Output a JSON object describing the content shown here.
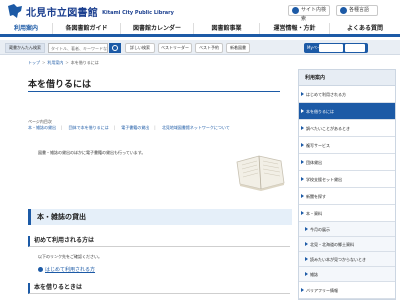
{
  "header": {
    "logo_text": "北見市立図書館",
    "logo_en": "Kitami City Public Library",
    "sitemap_button": "サイト内検索",
    "language_button": "各種言語"
  },
  "nav": {
    "items": [
      "利用案内",
      "各図書館ガイド",
      "図書館カレンダー",
      "図書館事業",
      "運営情報・方針",
      "よくある質問"
    ],
    "active_index": 0
  },
  "searchbar": {
    "label": "蔵書かんたん検索",
    "placeholder": "タイトル、著者、キーワードなど",
    "buttons": [
      "詳しい検索",
      "ベストリーダー",
      "ベスト予約",
      "新着図書"
    ],
    "mypage_label": "Myページ"
  },
  "breadcrumb": [
    "トップ",
    "利用案内",
    "本を借りるには"
  ],
  "main": {
    "title": "本を借りるには",
    "toc_heading": "ページ内目次",
    "toc_links": [
      "本・雑誌の貸出",
      "団体で本を借りるには",
      "電子書籍の貸出",
      "北見地域図書館ネットワークについて"
    ],
    "intro": "図書・雑誌の貸出のほかに電子書籍の貸出も行っています。",
    "section_title": "本・雑誌の貸出",
    "sub1_title": "初めて利用される方は",
    "sub1_text": "以下のリンク先をご確認ください。",
    "sub1_link": "はじめて利用される方",
    "sub2_title": "本を借りるときは"
  },
  "side": {
    "heading": "利用案内",
    "items": [
      {
        "label": "はじめて利用される方",
        "active": false,
        "sub": false
      },
      {
        "label": "本を借りるには",
        "active": true,
        "sub": false
      },
      {
        "label": "調べたいことがあるとき",
        "active": false,
        "sub": false
      },
      {
        "label": "複写サービス",
        "active": false,
        "sub": false
      },
      {
        "label": "団体貸出",
        "active": false,
        "sub": false
      },
      {
        "label": "学校支援セット貸出",
        "active": false,
        "sub": false
      },
      {
        "label": "新聞を探す",
        "active": false,
        "sub": false
      },
      {
        "label": "本・資料",
        "active": false,
        "sub": false
      },
      {
        "label": "今月の展示",
        "active": false,
        "sub": true
      },
      {
        "label": "北見・北海道の郷土資料",
        "active": false,
        "sub": true
      },
      {
        "label": "読みたい本が見つからないとき",
        "active": false,
        "sub": true
      },
      {
        "label": "雑誌",
        "active": false,
        "sub": true
      },
      {
        "label": "バリアフリー情報",
        "active": false,
        "sub": false
      }
    ]
  }
}
